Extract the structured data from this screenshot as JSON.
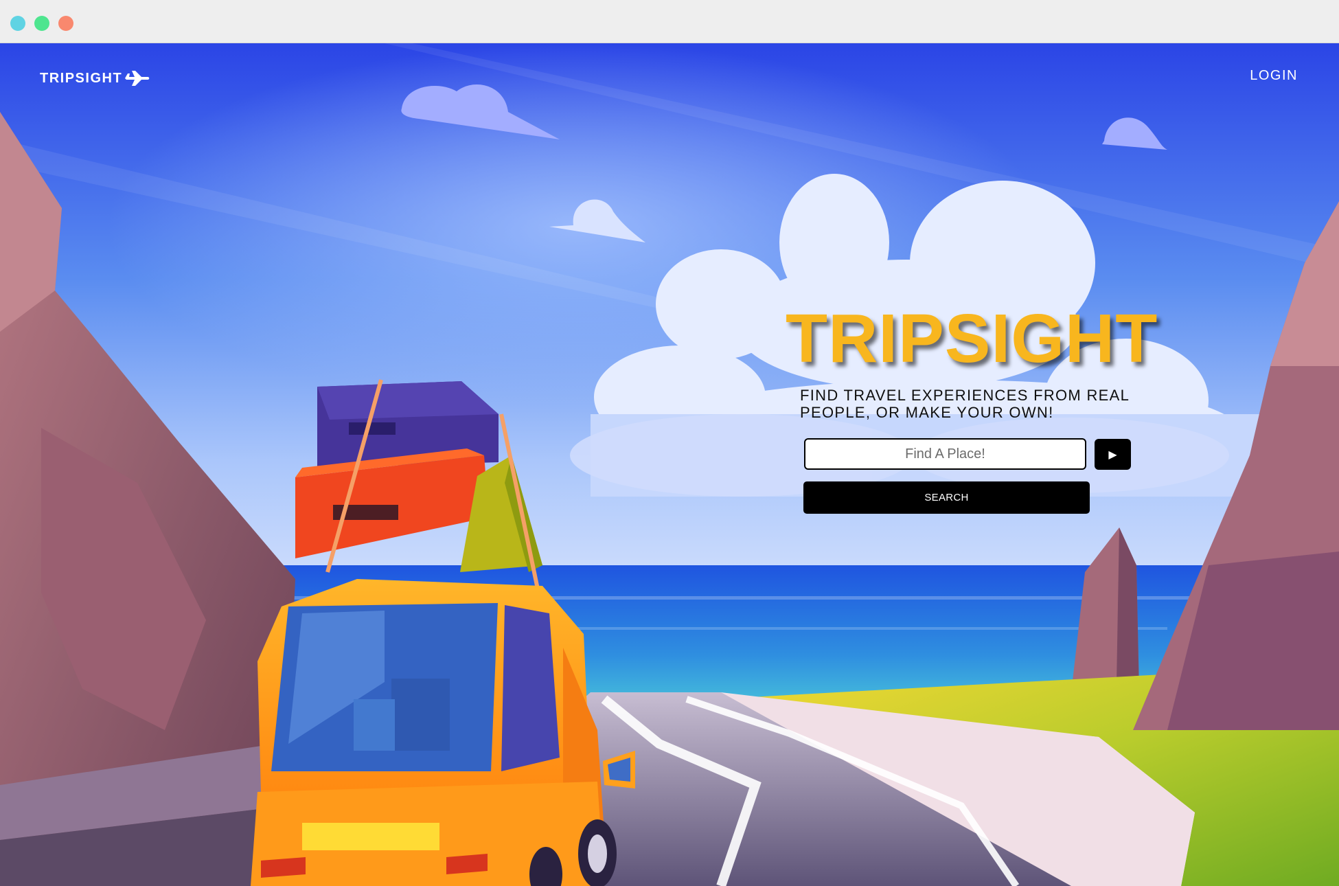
{
  "window": {
    "controls": [
      "close-dot",
      "minimize-dot",
      "maximize-dot"
    ]
  },
  "header": {
    "logo_text": "TRIPSIGHT",
    "logo_icon": "airplane-icon",
    "login_label": "LOGIN"
  },
  "hero": {
    "title": "TRIPSIGHT",
    "tagline": "FIND TRAVEL EXPERIENCES FROM REAL PEOPLE, OR MAKE YOUR OWN!",
    "search_placeholder": "Find A Place!",
    "search_value": "",
    "play_icon": "play-icon",
    "play_symbol": "▶",
    "search_button_label": "SEARCH"
  },
  "colors": {
    "sky_top": "#2b45e6",
    "title_yellow": "#f8b61e",
    "button_black": "#000000",
    "car_orange": "#ffa01c"
  }
}
